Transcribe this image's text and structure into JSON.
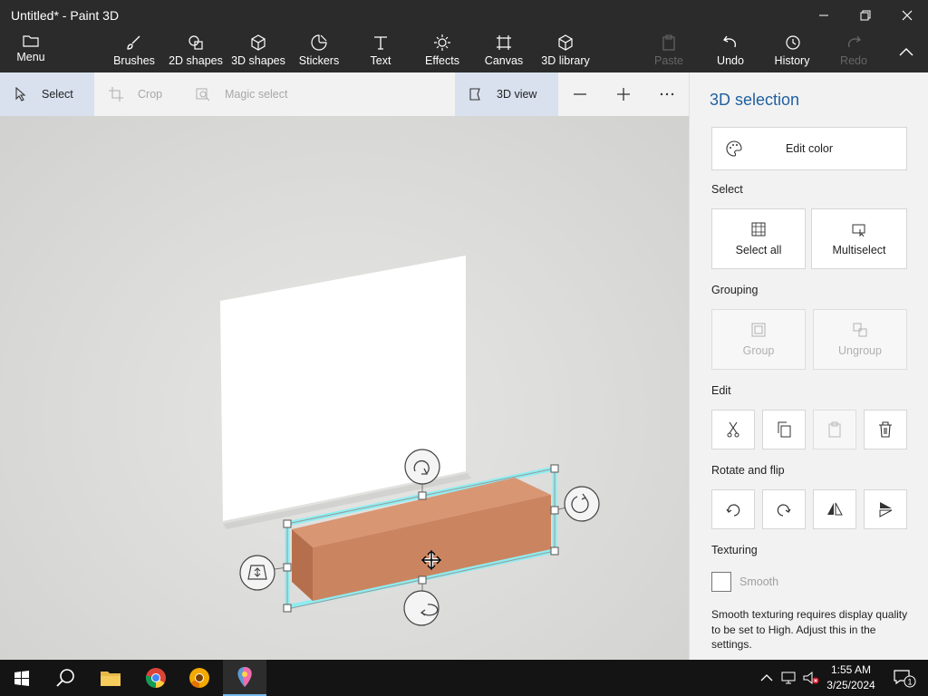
{
  "window": {
    "title": "Untitled* - Paint 3D"
  },
  "ribbon": {
    "menu": "Menu",
    "brushes": "Brushes",
    "shapes2d": "2D shapes",
    "shapes3d": "3D shapes",
    "stickers": "Stickers",
    "text": "Text",
    "effects": "Effects",
    "canvas": "Canvas",
    "library3d": "3D library",
    "paste": "Paste",
    "undo": "Undo",
    "history": "History",
    "redo": "Redo"
  },
  "toolbar": {
    "select": "Select",
    "crop": "Crop",
    "magic_select": "Magic select",
    "view3d": "3D view"
  },
  "panel": {
    "title": "3D selection",
    "edit_color": "Edit color",
    "select_heading": "Select",
    "select_all": "Select all",
    "multiselect": "Multiselect",
    "grouping_heading": "Grouping",
    "group": "Group",
    "ungroup": "Ungroup",
    "edit_heading": "Edit",
    "rotate_heading": "Rotate and flip",
    "texturing_heading": "Texturing",
    "smooth": "Smooth",
    "smooth_note": "Smooth texturing requires display quality to be set to High. Adjust this in the settings."
  },
  "taskbar": {
    "time": "1:55 AM",
    "date": "3/25/2024",
    "notification_count": "1"
  },
  "colors": {
    "accent": "#1f5f9f",
    "chrome_dark": "#2b2b2b",
    "selection_highlight": "#7ff0f5",
    "box_front": "#cb8460",
    "box_top": "#d99673",
    "box_side": "#b56f4c"
  }
}
